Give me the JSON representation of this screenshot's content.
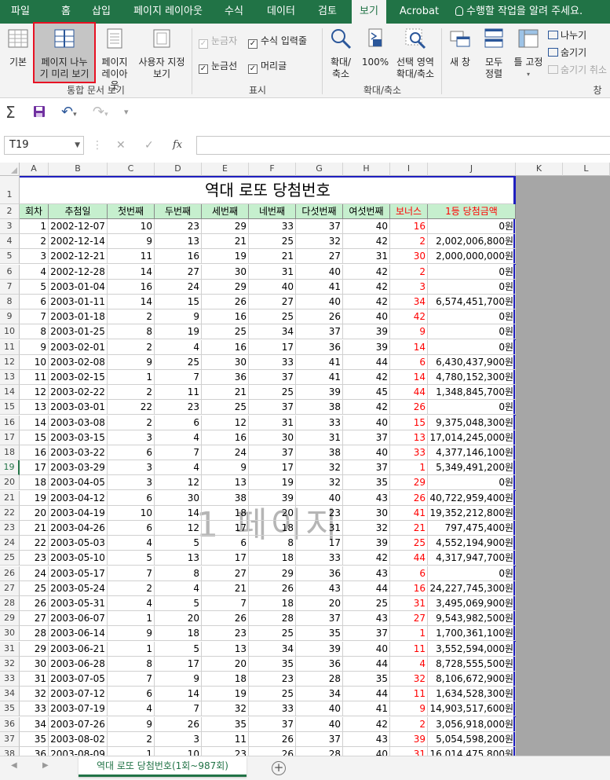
{
  "tabs": [
    {
      "label": "파일"
    },
    {
      "label": "홈"
    },
    {
      "label": "삽입"
    },
    {
      "label": "페이지 레이아웃"
    },
    {
      "label": "수식"
    },
    {
      "label": "데이터"
    },
    {
      "label": "검토"
    },
    {
      "label": "보기"
    },
    {
      "label": "Acrobat"
    }
  ],
  "tell_me": "수행할 작업을 알려 주세요.",
  "ribbon": {
    "normal": "기본",
    "page_break_line1": "페이지 나누",
    "page_break_line2": "기 미리 보기",
    "page_layout_line1": "페이지",
    "page_layout_line2": "레이아웃",
    "custom_line1": "사용자 지정",
    "custom_line2": "보기",
    "group_views": "통합 문서 보기",
    "ruler": "눈금자",
    "formula_bar": "수식 입력줄",
    "gridlines": "눈금선",
    "headings": "머리글",
    "group_show": "표시",
    "zoom_line1": "확대/",
    "zoom_line2": "축소",
    "zoom100": "100%",
    "zoom_sel_line1": "선택 영역",
    "zoom_sel_line2": "확대/축소",
    "group_zoom": "확대/축소",
    "new_window": "새 창",
    "arrange_line1": "모두",
    "arrange_line2": "정렬",
    "freeze": "틀 고정",
    "split": "나누기",
    "hide": "숨기기",
    "unhide": "숨기기 취소",
    "group_window": "창"
  },
  "formula": {
    "namebox": "T19",
    "fx": "fx",
    "value": ""
  },
  "columns": [
    "A",
    "B",
    "C",
    "D",
    "E",
    "F",
    "G",
    "H",
    "I",
    "J",
    "K",
    "L"
  ],
  "sheet_title": "역대 로또 당첨번호",
  "headers": [
    "회차",
    "추첨일",
    "첫번째",
    "두번째",
    "세번째",
    "네번째",
    "다섯번째",
    "여섯번째",
    "보너스",
    "1등 당첨금액"
  ],
  "rows": [
    [
      "1",
      "2002-12-07",
      "10",
      "23",
      "29",
      "33",
      "37",
      "40",
      "16",
      "0원"
    ],
    [
      "2",
      "2002-12-14",
      "9",
      "13",
      "21",
      "25",
      "32",
      "42",
      "2",
      "2,002,006,800원"
    ],
    [
      "3",
      "2002-12-21",
      "11",
      "16",
      "19",
      "21",
      "27",
      "31",
      "30",
      "2,000,000,000원"
    ],
    [
      "4",
      "2002-12-28",
      "14",
      "27",
      "30",
      "31",
      "40",
      "42",
      "2",
      "0원"
    ],
    [
      "5",
      "2003-01-04",
      "16",
      "24",
      "29",
      "40",
      "41",
      "42",
      "3",
      "0원"
    ],
    [
      "6",
      "2003-01-11",
      "14",
      "15",
      "26",
      "27",
      "40",
      "42",
      "34",
      "6,574,451,700원"
    ],
    [
      "7",
      "2003-01-18",
      "2",
      "9",
      "16",
      "25",
      "26",
      "40",
      "42",
      "0원"
    ],
    [
      "8",
      "2003-01-25",
      "8",
      "19",
      "25",
      "34",
      "37",
      "39",
      "9",
      "0원"
    ],
    [
      "9",
      "2003-02-01",
      "2",
      "4",
      "16",
      "17",
      "36",
      "39",
      "14",
      "0원"
    ],
    [
      "10",
      "2003-02-08",
      "9",
      "25",
      "30",
      "33",
      "41",
      "44",
      "6",
      "6,430,437,900원"
    ],
    [
      "11",
      "2003-02-15",
      "1",
      "7",
      "36",
      "37",
      "41",
      "42",
      "14",
      "4,780,152,300원"
    ],
    [
      "12",
      "2003-02-22",
      "2",
      "11",
      "21",
      "25",
      "39",
      "45",
      "44",
      "1,348,845,700원"
    ],
    [
      "13",
      "2003-03-01",
      "22",
      "23",
      "25",
      "37",
      "38",
      "42",
      "26",
      "0원"
    ],
    [
      "14",
      "2003-03-08",
      "2",
      "6",
      "12",
      "31",
      "33",
      "40",
      "15",
      "9,375,048,300원"
    ],
    [
      "15",
      "2003-03-15",
      "3",
      "4",
      "16",
      "30",
      "31",
      "37",
      "13",
      "17,014,245,000원"
    ],
    [
      "16",
      "2003-03-22",
      "6",
      "7",
      "24",
      "37",
      "38",
      "40",
      "33",
      "4,377,146,100원"
    ],
    [
      "17",
      "2003-03-29",
      "3",
      "4",
      "9",
      "17",
      "32",
      "37",
      "1",
      "5,349,491,200원"
    ],
    [
      "18",
      "2003-04-05",
      "3",
      "12",
      "13",
      "19",
      "32",
      "35",
      "29",
      "0원"
    ],
    [
      "19",
      "2003-04-12",
      "6",
      "30",
      "38",
      "39",
      "40",
      "43",
      "26",
      "40,722,959,400원"
    ],
    [
      "20",
      "2003-04-19",
      "10",
      "14",
      "18",
      "20",
      "23",
      "30",
      "41",
      "19,352,212,800원"
    ],
    [
      "21",
      "2003-04-26",
      "6",
      "12",
      "17",
      "18",
      "31",
      "32",
      "21",
      "797,475,400원"
    ],
    [
      "22",
      "2003-05-03",
      "4",
      "5",
      "6",
      "8",
      "17",
      "39",
      "25",
      "4,552,194,900원"
    ],
    [
      "23",
      "2003-05-10",
      "5",
      "13",
      "17",
      "18",
      "33",
      "42",
      "44",
      "4,317,947,700원"
    ],
    [
      "24",
      "2003-05-17",
      "7",
      "8",
      "27",
      "29",
      "36",
      "43",
      "6",
      "0원"
    ],
    [
      "25",
      "2003-05-24",
      "2",
      "4",
      "21",
      "26",
      "43",
      "44",
      "16",
      "24,227,745,300원"
    ],
    [
      "26",
      "2003-05-31",
      "4",
      "5",
      "7",
      "18",
      "20",
      "25",
      "31",
      "3,495,069,900원"
    ],
    [
      "27",
      "2003-06-07",
      "1",
      "20",
      "26",
      "28",
      "37",
      "43",
      "27",
      "9,543,982,500원"
    ],
    [
      "28",
      "2003-06-14",
      "9",
      "18",
      "23",
      "25",
      "35",
      "37",
      "1",
      "1,700,361,100원"
    ],
    [
      "29",
      "2003-06-21",
      "1",
      "5",
      "13",
      "34",
      "39",
      "40",
      "11",
      "3,552,594,000원"
    ],
    [
      "30",
      "2003-06-28",
      "8",
      "17",
      "20",
      "35",
      "36",
      "44",
      "4",
      "8,728,555,500원"
    ],
    [
      "31",
      "2003-07-05",
      "7",
      "9",
      "18",
      "23",
      "28",
      "35",
      "32",
      "8,106,672,900원"
    ],
    [
      "32",
      "2003-07-12",
      "6",
      "14",
      "19",
      "25",
      "34",
      "44",
      "11",
      "1,634,528,300원"
    ],
    [
      "33",
      "2003-07-19",
      "4",
      "7",
      "32",
      "33",
      "40",
      "41",
      "9",
      "14,903,517,600원"
    ],
    [
      "34",
      "2003-07-26",
      "9",
      "26",
      "35",
      "37",
      "40",
      "42",
      "2",
      "3,056,918,000원"
    ],
    [
      "35",
      "2003-08-02",
      "2",
      "3",
      "11",
      "26",
      "37",
      "43",
      "39",
      "5,054,598,200원"
    ],
    [
      "36",
      "2003-08-09",
      "1",
      "10",
      "23",
      "26",
      "28",
      "40",
      "31",
      "16,014,475,800원"
    ]
  ],
  "row_numbers": [
    "1",
    "2",
    "3",
    "4",
    "5",
    "6",
    "7",
    "8",
    "9",
    "10",
    "11",
    "12",
    "13",
    "14",
    "15",
    "16",
    "17",
    "18",
    "19",
    "20",
    "21",
    "22",
    "23",
    "24",
    "25",
    "26",
    "27",
    "28",
    "29",
    "30",
    "31",
    "32",
    "33",
    "34",
    "35",
    "36",
    "37",
    "38"
  ],
  "watermark": "1 페이지",
  "sheet_tab": "역대 로또 당첨번호(1회~987회)",
  "selected_row": "19"
}
